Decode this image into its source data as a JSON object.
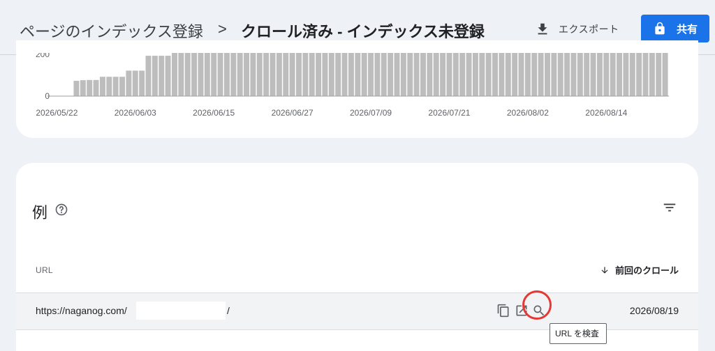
{
  "header": {
    "breadcrumb_parent": "ページのインデックス登録",
    "breadcrumb_separator": ">",
    "page_title": "クロール済み - インデックス未登録",
    "export_label": "エクスポート",
    "share_label": "共有",
    "accent_color": "#1a73e8"
  },
  "chart_data": {
    "type": "bar",
    "ylabel": "",
    "y_ticks": [
      "0"
    ],
    "y_top_tick_partial": "200",
    "x_tick_labels": [
      "2026/05/22",
      "2026/06/03",
      "2026/06/15",
      "2026/06/27",
      "2026/07/09",
      "2026/07/21",
      "2026/08/02",
      "2026/08/14"
    ],
    "start_date": "2026/05/21",
    "bar_color": "#bdbdbd",
    "values": [
      0,
      0,
      0,
      0,
      72,
      75,
      76,
      76,
      91,
      91,
      91,
      91,
      120,
      120,
      120,
      190,
      190,
      190,
      190,
      200,
      200,
      200,
      200,
      200,
      200,
      200,
      200,
      200,
      200,
      200,
      200,
      200,
      200,
      200,
      200,
      200,
      200,
      200,
      200,
      200,
      200,
      200,
      200,
      200,
      200,
      200,
      200,
      200,
      200,
      200,
      200,
      200,
      200,
      200,
      200,
      200,
      200,
      200,
      200,
      200,
      200,
      200,
      200,
      200,
      200,
      200,
      200,
      200,
      200,
      200,
      200,
      200,
      200,
      200,
      200,
      200,
      200,
      200,
      200,
      200,
      200,
      200,
      200,
      200,
      200,
      200,
      200,
      200,
      200,
      200,
      200,
      200,
      200,
      200,
      200
    ],
    "ylim": [
      0,
      240
    ]
  },
  "examples": {
    "title": "例",
    "columns": {
      "url": "URL",
      "last_crawl": "前回のクロール",
      "sort": "descending"
    },
    "rows": [
      {
        "url_prefix": "https://naganog.com/",
        "url_suffix": "/",
        "last_crawl": "2026/08/19"
      }
    ],
    "row_actions": {
      "tooltip": "URL を検査"
    },
    "highlight_color": "#e53935"
  }
}
